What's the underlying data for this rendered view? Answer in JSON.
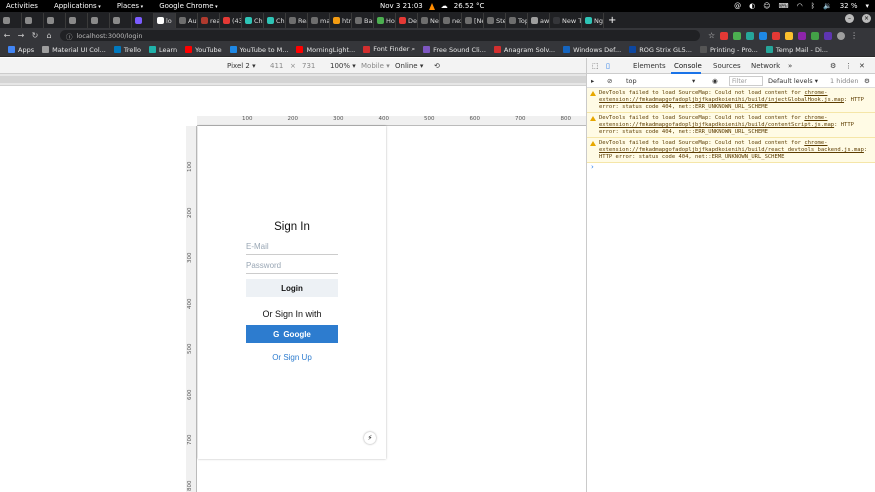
{
  "topbar": {
    "activities": "Activities",
    "applications": "Applications",
    "places": "Places",
    "chrome": "Google Chrome",
    "datetime": "Nov 3  21:03",
    "weather": "26.52 °C",
    "battery": "32 %"
  },
  "tabs": [
    {
      "label": "",
      "color": "#8a8a8a"
    },
    {
      "label": "",
      "color": "#8a8a8a"
    },
    {
      "label": "",
      "color": "#8a8a8a"
    },
    {
      "label": "",
      "color": "#8a8a8a"
    },
    {
      "label": "",
      "color": "#8a8a8a"
    },
    {
      "label": "",
      "color": "#8a8a8a"
    },
    {
      "label": "",
      "color": "#7b5cff"
    },
    {
      "label": "lo",
      "color": "#ffffff"
    },
    {
      "label": "Auth",
      "color": "#6e6e6e"
    },
    {
      "label": "react",
      "color": "#b03a2e"
    },
    {
      "label": "(433",
      "color": "#e53935"
    },
    {
      "label": "Chat",
      "color": "#2ec4b6"
    },
    {
      "label": "Chat",
      "color": "#2ec4b6"
    },
    {
      "label": "Reac",
      "color": "#6e6e6e"
    },
    {
      "label": "mati",
      "color": "#6e6e6e"
    },
    {
      "label": "html",
      "color": "#f39c12"
    },
    {
      "label": "Basic",
      "color": "#6e6e6e"
    },
    {
      "label": "How",
      "color": "#4caf50"
    },
    {
      "label": "Debu",
      "color": "#e53935"
    },
    {
      "label": "Next",
      "color": "#6e6e6e"
    },
    {
      "label": "next",
      "color": "#6e6e6e"
    },
    {
      "label": "[Nex",
      "color": "#6e6e6e"
    },
    {
      "label": "Step",
      "color": "#6e6e6e"
    },
    {
      "label": "Top",
      "color": "#6e6e6e"
    },
    {
      "label": "awal",
      "color": "#9e9e9e"
    },
    {
      "label": "New Tab",
      "color": "#35363a"
    },
    {
      "label": "Ngal",
      "color": "#2ec4b6"
    }
  ],
  "address": {
    "url": "localhost:3000/login"
  },
  "bookmarks": [
    {
      "label": "Apps",
      "color": "#4285f4"
    },
    {
      "label": "Material UI Col...",
      "color": "#9e9e9e"
    },
    {
      "label": "Trello",
      "color": "#0079bf"
    },
    {
      "label": "Learn",
      "color": "#20b2aa"
    },
    {
      "label": "YouTube",
      "color": "#ff0000"
    },
    {
      "label": "YouTube to M...",
      "color": "#1e88e5"
    },
    {
      "label": "MorningLight...",
      "color": "#ff0000"
    },
    {
      "label": "Font Finder ⌕",
      "color": "#d32f2f"
    },
    {
      "label": "Free Sound Cli...",
      "color": "#7e57c2"
    },
    {
      "label": "Anagram Solv...",
      "color": "#d32f2f"
    },
    {
      "label": "Windows Def...",
      "color": "#1565c0"
    },
    {
      "label": "ROG Strix GL5...",
      "color": "#0d47a1"
    },
    {
      "label": "Printing - Pro...",
      "color": "#555555"
    },
    {
      "label": "Temp Mail - Di...",
      "color": "#26a69a"
    }
  ],
  "device_toolbar": {
    "device": "Pixel 2",
    "width": "411",
    "times": "×",
    "height": "731",
    "zoom": "100%",
    "mode": "Mobile",
    "network": "Online"
  },
  "ruler": {
    "h": [
      "100",
      "200",
      "300",
      "400",
      "500",
      "600",
      "700",
      "800"
    ],
    "v": [
      "100",
      "200",
      "300",
      "400",
      "500",
      "600",
      "700",
      "800"
    ]
  },
  "login": {
    "title": "Sign In",
    "email_placeholder": "E-Mail",
    "password_placeholder": "Password",
    "login_button": "Login",
    "or_text": "Or Sign In with",
    "google_button": "Google",
    "google_icon": "G",
    "signup_link": "Or Sign Up",
    "bolt_icon": "⚡"
  },
  "devtools": {
    "tabs": [
      "Elements",
      "Console",
      "Sources",
      "Network"
    ],
    "more": "»",
    "context": "top",
    "filter_placeholder": "Filter",
    "levels": "Default levels",
    "hidden": "1 hidden",
    "messages": [
      {
        "prefix": "DevTools failed to load SourceMap: Could not load content for ",
        "link": "chrome-extension://fmkadmapgofadopljbjfkapdkoienihi/build/injectGlobalHook.js.map",
        "suffix": ": HTTP error: status code 404, net::ERR_UNKNOWN_URL_SCHEME"
      },
      {
        "prefix": "DevTools failed to load SourceMap: Could not load content for ",
        "link": "chrome-extension://fmkadmapgofadopljbjfkapdkoienihi/build/contentScript.js.map",
        "suffix": ": HTTP error: status code 404, net::ERR_UNKNOWN_URL_SCHEME"
      },
      {
        "prefix": "DevTools failed to load SourceMap: Could not load content for ",
        "link": "chrome-extension://fmkadmapgofadopljbjfkapdkoienihi/build/react_devtools_backend.js.map",
        "suffix": ": HTTP error: status code 404, net::ERR_UNKNOWN_URL_SCHEME"
      }
    ],
    "prompt": "›"
  }
}
